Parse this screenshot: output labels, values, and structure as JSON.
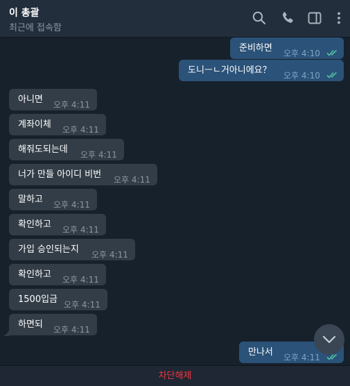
{
  "header": {
    "title": "이 총괄",
    "subtitle": "최근에 접속함",
    "icons": [
      "search-icon",
      "phone-icon",
      "sidebar-icon",
      "more-vertical-icon"
    ]
  },
  "messages": [
    {
      "dir": "out",
      "text": "준비하면",
      "time": "오후 4:10",
      "read": true
    },
    {
      "dir": "out",
      "text": "도니ㅡㄴ거아니에요？",
      "time": "오후 4:10",
      "read": true
    },
    {
      "dir": "in",
      "text": "아니면",
      "time": "오후 4:11"
    },
    {
      "dir": "in",
      "text": "계좌이체",
      "time": "오후 4:11"
    },
    {
      "dir": "in",
      "text": "해줘도되는데",
      "time": "오후 4:11"
    },
    {
      "dir": "in",
      "text": "너가 만들 아이디 비번",
      "time": "오후 4:11"
    },
    {
      "dir": "in",
      "text": "말하고",
      "time": "오후 4:11"
    },
    {
      "dir": "in",
      "text": "확인하고",
      "time": "오후 4:11"
    },
    {
      "dir": "in",
      "text": "가입 승인되는지",
      "time": "오후 4:11"
    },
    {
      "dir": "in",
      "text": "확인하고",
      "time": "오후 4:11"
    },
    {
      "dir": "in",
      "text": "1500입금",
      "time": "오후 4:11"
    },
    {
      "dir": "in",
      "text": "하면되",
      "time": "오후 4:11"
    },
    {
      "dir": "out",
      "text": "만나서",
      "time": "오후 4:11",
      "read": true
    }
  ],
  "footer": {
    "unblock_label": "차단해제"
  },
  "colors": {
    "accent_red": "#ec3942",
    "read_check": "#4fc3a0",
    "incoming_bubble": "#333d47",
    "outgoing_bubble": "#2b5278"
  }
}
